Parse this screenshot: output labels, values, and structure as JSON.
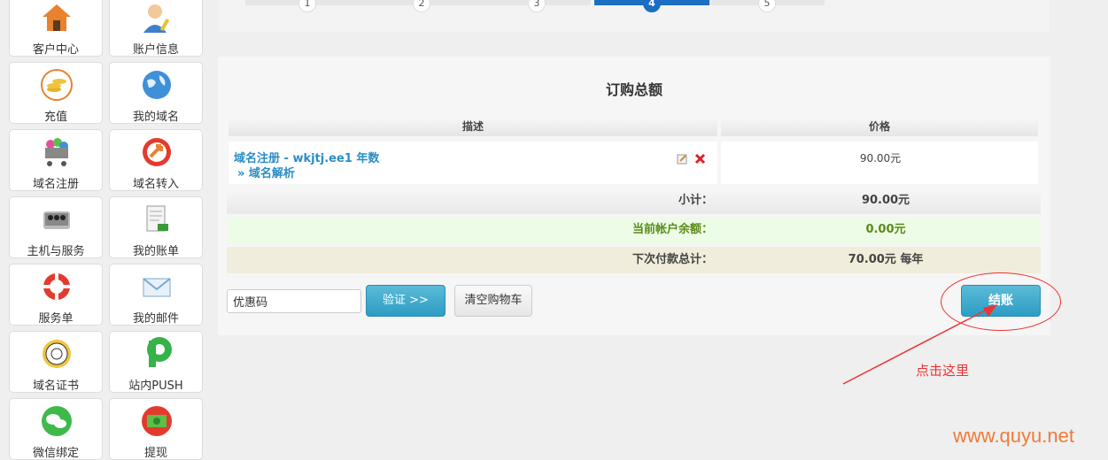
{
  "sidebar": {
    "items": [
      {
        "label": "客户中心"
      },
      {
        "label": "账户信息"
      },
      {
        "label": "充值"
      },
      {
        "label": "我的域名"
      },
      {
        "label": "域名注册"
      },
      {
        "label": "域名转入"
      },
      {
        "label": "主机与服务"
      },
      {
        "label": "我的账单"
      },
      {
        "label": "服务单"
      },
      {
        "label": "我的邮件"
      },
      {
        "label": "域名证书"
      },
      {
        "label": "站内PUSH"
      },
      {
        "label": "微信绑定"
      },
      {
        "label": "提现"
      }
    ]
  },
  "steps": {
    "items": [
      "1",
      "2",
      "3",
      "4",
      "5"
    ],
    "active": "4"
  },
  "order": {
    "title": "订购总额",
    "col_desc": "描述",
    "col_price": "价格",
    "item": {
      "name": "域名注册 - wkjtj.ee1 年数",
      "sub": "» 域名解析",
      "price": "90.00元"
    },
    "subtotal": {
      "label": "小计：",
      "value": "90.00元"
    },
    "balance": {
      "label": "当前帐户余额：",
      "value": "0.00元"
    },
    "next": {
      "label": "下次付款总计：",
      "value": "70.00元 每年"
    }
  },
  "controls": {
    "coupon_value": "优惠码",
    "verify": "验证 >>",
    "clear_cart": "清空购物车",
    "checkout": "结账"
  },
  "annotation": {
    "text": "点击这里"
  },
  "watermark": "www.quyu.net",
  "colors": {
    "accent": "#2d9dc4",
    "link": "#2a8dc5",
    "step_active": "#1a6fc3",
    "annotation": "#ee3333",
    "balance_bg": "#edfce6",
    "next_bg": "#f1eddc"
  }
}
